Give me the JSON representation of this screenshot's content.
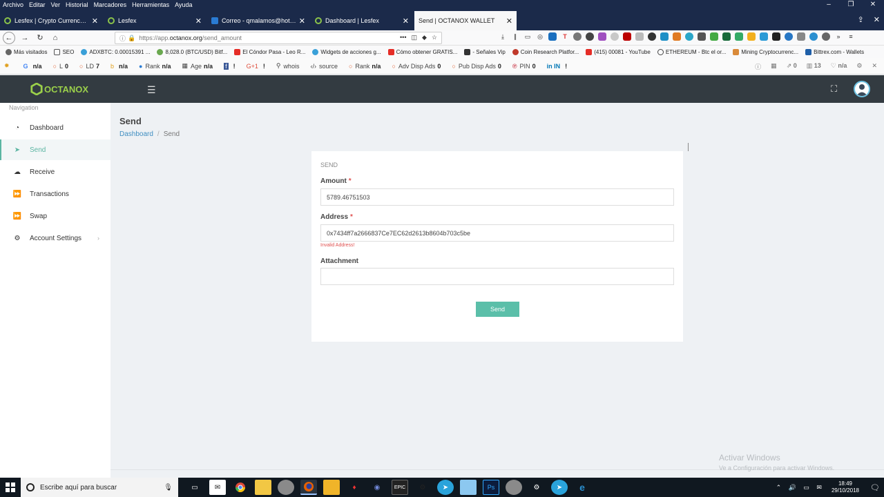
{
  "browser": {
    "menu": [
      "Archivo",
      "Editar",
      "Ver",
      "Historial",
      "Marcadores",
      "Herramientas",
      "Ayuda"
    ],
    "tabs": [
      {
        "label": "Lesfex | Crypto Currency Excha",
        "icon": "lesfex-icon"
      },
      {
        "label": "Lesfex",
        "icon": "lesfex-icon"
      },
      {
        "label": "Correo - qmalamos@hotmail.",
        "icon": "outlook-icon"
      },
      {
        "label": "Dashboard | Lesfex",
        "icon": "lesfex-icon"
      },
      {
        "label": "Send | OCTANOX WALLET",
        "icon": "octanox-icon",
        "active": true
      }
    ],
    "url": {
      "prefix": "https://app.",
      "host": "octanox.org",
      "path": "/send_amount"
    },
    "bookmarks": [
      "Más visitados",
      "SEO",
      "ADXBTC: 0.00015391 ...",
      "8,028.0 (BTC/USD) Bitf...",
      "El Cóndor Pasa - Leo R...",
      "Widgets de acciones g...",
      "Cómo obtener GRATIS...",
      "- Señales Vip",
      "Coin Research Platfor...",
      "(415) 00081 - YouTube",
      "ETHEREUM - Btc el or...",
      "Mining Cryptocurrenc...",
      "Bittrex.com - Wallets"
    ],
    "seo_items": [
      {
        "label": "G",
        "value": "n/a"
      },
      {
        "label": "L",
        "value": "0"
      },
      {
        "label": "LD",
        "value": "7"
      },
      {
        "label": "b",
        "value": "n/a"
      },
      {
        "label": "Rank",
        "value": "n/a"
      },
      {
        "label": "Age",
        "value": "n/a"
      },
      {
        "label": "f",
        "value": "!"
      },
      {
        "label": "G+1",
        "value": "!"
      },
      {
        "label": "whois",
        "value": ""
      },
      {
        "label": "source",
        "value": ""
      },
      {
        "label": "Rank",
        "value": "n/a"
      },
      {
        "label": "Adv Disp Ads",
        "value": "0"
      },
      {
        "label": "Pub Disp Ads",
        "value": "0"
      },
      {
        "label": "PIN",
        "value": "0"
      },
      {
        "label": "in IN",
        "value": "!"
      }
    ],
    "seo_right": [
      "0",
      "13",
      "n/a"
    ]
  },
  "app": {
    "logo_text": "OCTANOX",
    "nav_title": "Navigation",
    "nav": [
      {
        "label": "Dashboard",
        "icon": "dashboard-icon",
        "glyph": "◔"
      },
      {
        "label": "Send",
        "icon": "send-icon",
        "glyph": "➤",
        "active": true
      },
      {
        "label": "Receive",
        "icon": "cloud-download-icon",
        "glyph": "☁"
      },
      {
        "label": "Transactions",
        "icon": "forward-icon",
        "glyph": "⏩"
      },
      {
        "label": "Swap",
        "icon": "forward-icon",
        "glyph": "⏩"
      },
      {
        "label": "Account Settings",
        "icon": "gear-icon",
        "glyph": "⚙",
        "chevron": true
      }
    ],
    "page_title": "Send",
    "breadcrumb": {
      "home": "Dashboard",
      "separator": "/",
      "current": "Send"
    },
    "form": {
      "card_title": "SEND",
      "amount_label": "Amount",
      "amount_value": "5789.46751503",
      "address_label": "Address",
      "address_value": "0x7434ff7a2666837Ce7EC62d2613b8604b703c5be",
      "address_error": "Invalid Address!",
      "attachment_label": "Attachment",
      "attachment_value": "",
      "required_mark": "*",
      "submit_label": "Send"
    },
    "accent_color": "#5bbfa9",
    "error_color": "#e0504f"
  },
  "windows": {
    "watermark_title": "Activar Windows",
    "watermark_sub": "Ve a Configuración para activar Windows.",
    "search_placeholder": "Escribe aquí para buscar",
    "time": "18:49",
    "date": "29/10/2018"
  }
}
